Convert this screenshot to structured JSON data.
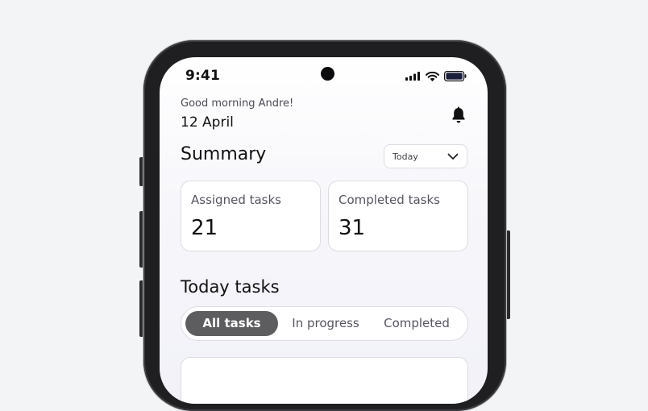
{
  "status_bar": {
    "time": "9:41"
  },
  "header": {
    "greeting": "Good morning Andre!",
    "date": "12 April"
  },
  "summary": {
    "title": "Summary",
    "period": "Today",
    "cards": [
      {
        "label": "Assigned tasks",
        "value": "21"
      },
      {
        "label": "Completed tasks",
        "value": "31"
      }
    ]
  },
  "today": {
    "title": "Today tasks",
    "tabs": [
      {
        "label": "All tasks",
        "active": true
      },
      {
        "label": "In progress",
        "active": false
      },
      {
        "label": "Completed",
        "active": false
      }
    ]
  },
  "colors": {
    "active_tab": "#5d5d60",
    "background": "#f3f4f6",
    "phone_frame": "#1f1f22"
  },
  "icons": [
    "wifi-icon",
    "signal-icon",
    "battery-icon",
    "bell-icon",
    "chevron-down-icon"
  ]
}
